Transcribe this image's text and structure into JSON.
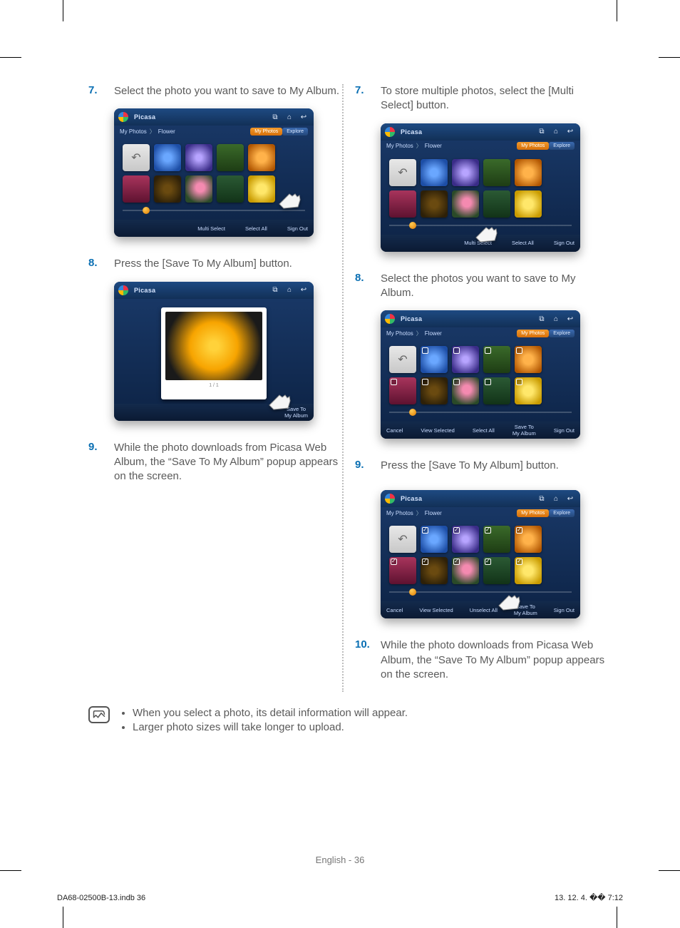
{
  "left": {
    "steps": [
      {
        "num": "7.",
        "text": "Select the photo you want to save to My Album."
      },
      {
        "num": "8.",
        "text": "Press the [Save To My Album] button."
      },
      {
        "num": "9.",
        "text": "While the photo downloads from Picasa Web Album, the “Save To My Album” popup appears on the screen."
      }
    ]
  },
  "right": {
    "steps": [
      {
        "num": "7.",
        "text": "To store multiple photos, select the [Multi Select] button."
      },
      {
        "num": "8.",
        "text": "Select the photos you want to save to My Album."
      },
      {
        "num": "9.",
        "text": "Press the [Save To My Album] button."
      },
      {
        "num": "10.",
        "text": "While the photo downloads from Picasa Web Album, the “Save To My Album” popup appears on the screen."
      }
    ]
  },
  "shots": {
    "brand": "Picasa",
    "crumb": {
      "root": "My Photos",
      "album": "Flower"
    },
    "tabs": [
      "My Photos",
      "Explore"
    ],
    "detail": {
      "counter": "1 / 1"
    },
    "footerA": [
      "Multi Select",
      "Select All",
      "Sign Out"
    ],
    "footerB": [
      "Save To\nMy Album"
    ],
    "footerC": [
      "Cancel",
      "View Selected",
      "Select All",
      "Save To\nMy Album",
      "Sign Out"
    ],
    "footerD": [
      "Cancel",
      "View Selected",
      "Unselect All",
      "Save To\nMy Album",
      "Sign Out"
    ]
  },
  "notes": [
    "When you select a photo, its detail information will appear.",
    "Larger photo sizes will take longer to upload."
  ],
  "footer": {
    "center": "English - 36",
    "left": "DA68-02500B-13.indb   36",
    "right": "13. 12. 4.   �� 7:12"
  }
}
